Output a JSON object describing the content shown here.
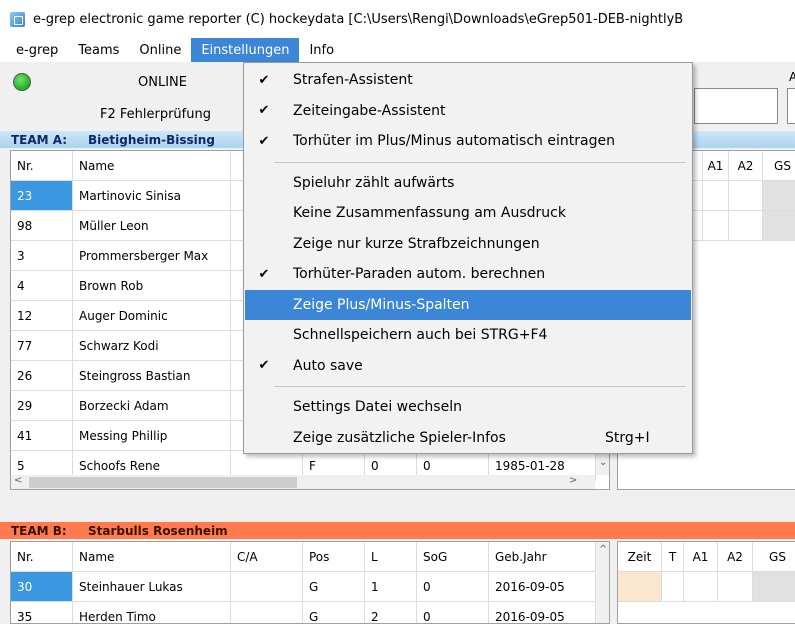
{
  "window": {
    "title": "e-grep   electronic game reporter (C) hockeydata [C:\\Users\\Rengi\\Downloads\\eGrep501-DEB-nightlyB"
  },
  "menubar": [
    "e-grep",
    "Teams",
    "Online",
    "Einstellungen",
    "Info"
  ],
  "status": {
    "online": "ONLINE",
    "check": "F2 Fehlerprüfung",
    "side_label": "A",
    "led_color": "#2fbf2f"
  },
  "team_a": {
    "label": "TEAM A:",
    "name": "Bietigheim-Bissing",
    "columns": [
      "Nr.",
      "Name",
      "",
      "",
      "",
      "",
      ""
    ],
    "rows": [
      {
        "nr": "23",
        "name": "Martinovic Sinisa",
        "ca": "",
        "pos": "",
        "l": "",
        "sog": "",
        "geb": ""
      },
      {
        "nr": "98",
        "name": "Müller Leon",
        "ca": "",
        "pos": "",
        "l": "",
        "sog": "",
        "geb": ""
      },
      {
        "nr": "3",
        "name": "Prommersberger Max",
        "ca": "",
        "pos": "",
        "l": "",
        "sog": "",
        "geb": ""
      },
      {
        "nr": "4",
        "name": "Brown Rob",
        "ca": "",
        "pos": "",
        "l": "",
        "sog": "",
        "geb": ""
      },
      {
        "nr": "12",
        "name": "Auger Dominic",
        "ca": "",
        "pos": "",
        "l": "",
        "sog": "",
        "geb": ""
      },
      {
        "nr": "77",
        "name": "Schwarz Kodi",
        "ca": "",
        "pos": "",
        "l": "",
        "sog": "",
        "geb": ""
      },
      {
        "nr": "26",
        "name": "Steingross Bastian",
        "ca": "",
        "pos": "",
        "l": "",
        "sog": "",
        "geb": ""
      },
      {
        "nr": "29",
        "name": "Borzecki Adam",
        "ca": "",
        "pos": "",
        "l": "",
        "sog": "",
        "geb": ""
      },
      {
        "nr": "41",
        "name": "Messing Phillip",
        "ca": "",
        "pos": "",
        "l": "",
        "sog": "",
        "geb": ""
      },
      {
        "nr": "5",
        "name": "Schoofs Rene",
        "ca": "",
        "pos": "F",
        "l": "0",
        "sog": "0",
        "geb": "1985-01-28"
      }
    ],
    "penalty_columns": [
      "",
      "A1",
      "A2",
      "GS"
    ]
  },
  "team_b": {
    "label": "TEAM B:",
    "name": "Starbulls Rosenheim",
    "columns": [
      "Nr.",
      "Name",
      "C/A",
      "Pos",
      "L",
      "SoG",
      "Geb.Jahr"
    ],
    "rows": [
      {
        "nr": "30",
        "name": "Steinhauer Lukas",
        "ca": "",
        "pos": "G",
        "l": "1",
        "sog": "0",
        "geb": "2016-09-05"
      },
      {
        "nr": "35",
        "name": "Herden Timo",
        "ca": "",
        "pos": "G",
        "l": "2",
        "sog": "0",
        "geb": "2016-09-05"
      }
    ],
    "penalty_columns": [
      "Zeit",
      "T",
      "A1",
      "A2",
      "GS"
    ]
  },
  "dropdown": [
    {
      "label": "Strafen-Assistent",
      "checked": true,
      "shortcut": ""
    },
    {
      "label": "Zeiteingabe-Assistent",
      "checked": true,
      "shortcut": ""
    },
    {
      "label": "Torhüter im Plus/Minus automatisch eintragen",
      "checked": true,
      "shortcut": ""
    },
    {
      "separator": true
    },
    {
      "label": "Spieluhr zählt aufwärts",
      "checked": false,
      "shortcut": ""
    },
    {
      "label": "Keine Zusammenfassung am Ausdruck",
      "checked": false,
      "shortcut": ""
    },
    {
      "label": "Zeige nur kurze Strafbzeichnungen",
      "checked": false,
      "shortcut": ""
    },
    {
      "label": "Torhüter-Paraden autom. berechnen",
      "checked": true,
      "shortcut": ""
    },
    {
      "label": "Zeige Plus/Minus-Spalten",
      "checked": false,
      "shortcut": "",
      "highlighted": true
    },
    {
      "label": "Schnellspeichern auch bei STRG+F4",
      "checked": false,
      "shortcut": ""
    },
    {
      "label": "Auto save",
      "checked": true,
      "shortcut": ""
    },
    {
      "separator": true
    },
    {
      "label": "Settings Datei wechseln",
      "checked": false,
      "shortcut": ""
    },
    {
      "label": "Zeige zusätzliche Spieler-Infos",
      "checked": false,
      "shortcut": "Strg+I"
    }
  ],
  "icons": {
    "check": "check-icon",
    "scroll_up": "scroll-up-icon",
    "scroll_down": "scroll-down-icon",
    "scroll_left": "scroll-left-icon",
    "scroll_right": "scroll-right-icon"
  },
  "colors": {
    "accent": "#3b86d6",
    "selected_cell": "#3b97e0",
    "team_a_header": "#a9d3f0",
    "team_b_header": "#ff7b4f"
  }
}
